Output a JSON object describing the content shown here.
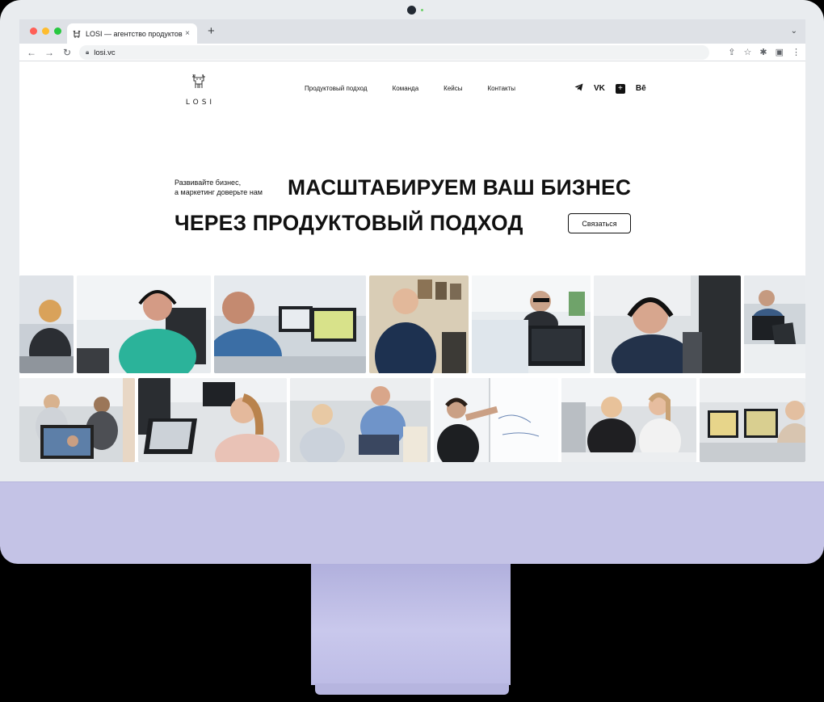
{
  "browser": {
    "tab_title": "LOSI — агентство продуктового",
    "url": "losi.vc",
    "dot_colors": [
      "#ff5f57",
      "#febc2e",
      "#28c840"
    ]
  },
  "site": {
    "logo_text": "LOSI",
    "nav": [
      "Продуктовый подход",
      "Команда",
      "Кейсы",
      "Контакты"
    ],
    "socials": [
      "telegram-icon",
      "vk-icon",
      "plus-icon",
      "behance-icon"
    ],
    "social_vk": "VK",
    "social_behance": "Bē",
    "tagline_line1": "Развивайте бизнес,",
    "tagline_line2": "а маркетинг доверьте нам",
    "headline_line1": "МАСШТАБИРУЕМ ВАШ БИЗНЕС",
    "headline_line2": "ЧЕРЕЗ ПРОДУКТОВЫЙ ПОДХОД",
    "cta_label": "Связаться"
  },
  "colors": {
    "chin": "#c4c3e6",
    "stand": "#b1b0dd",
    "bezel": "#e9ecef"
  }
}
